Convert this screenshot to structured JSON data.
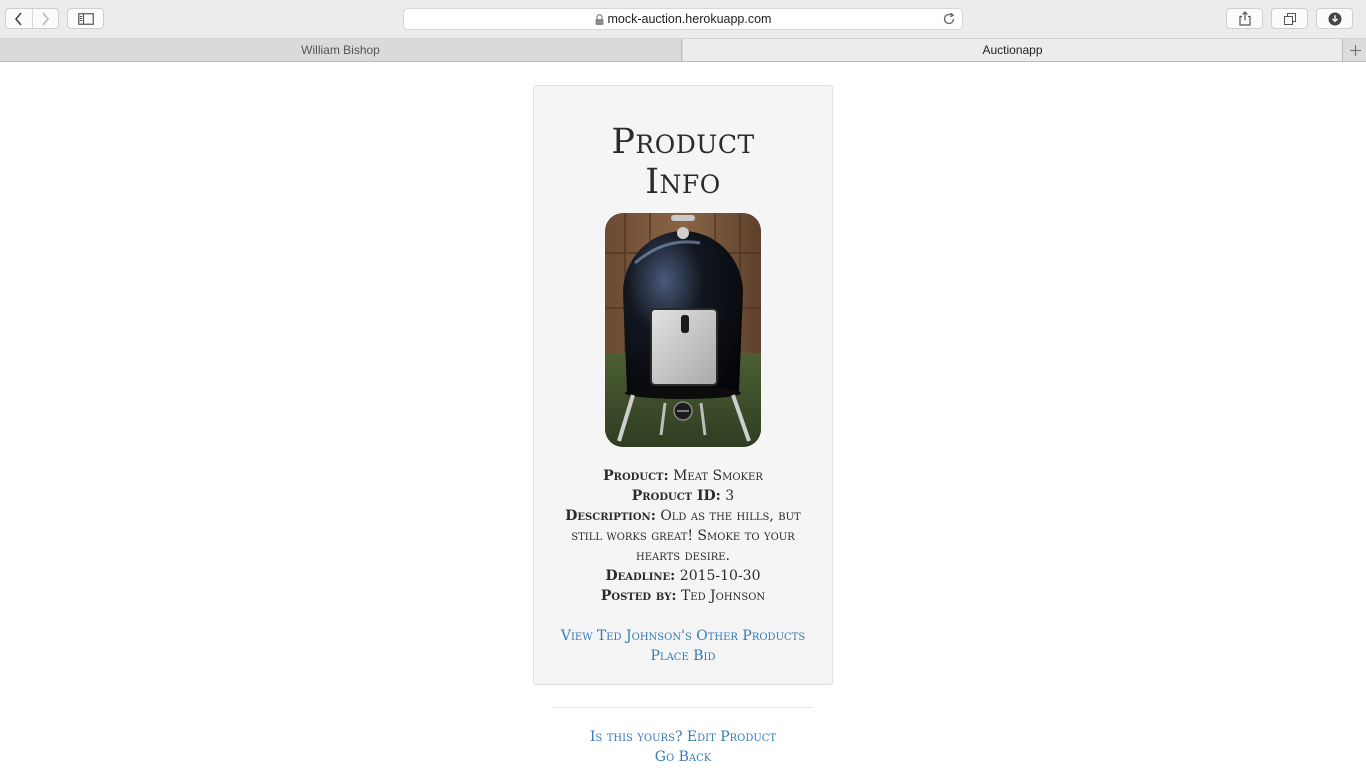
{
  "browser": {
    "url": "mock-auction.herokuapp.com",
    "tabs": [
      {
        "label": "William Bishop"
      },
      {
        "label": "Auctionapp"
      }
    ]
  },
  "page": {
    "title_line1": "Product",
    "title_line2": "Info",
    "product_image_alt": "Meat Smoker photo",
    "fields": {
      "product_label": "Product:",
      "product_value": "Meat Smoker",
      "id_label": "Product ID:",
      "id_value": "3",
      "description_label": "Description:",
      "description_value": "Old as the hills, but still works great! Smoke to your hearts desire.",
      "deadline_label": "Deadline:",
      "deadline_value": "2015-10-30",
      "posted_label": "Posted by:",
      "posted_value": "Ted Johnson"
    },
    "links": {
      "view_other": "View Ted Johnson's Other Products",
      "place_bid": "Place Bid",
      "edit_product": "Is this yours? Edit Product",
      "go_back": "Go Back"
    }
  }
}
